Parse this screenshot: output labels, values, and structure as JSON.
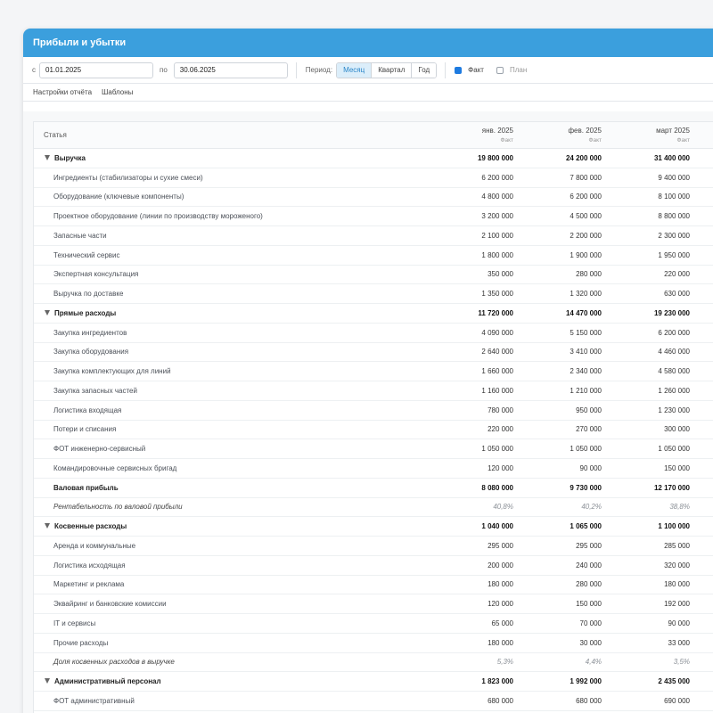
{
  "window": {
    "title": "Прибыли и убытки"
  },
  "toolbar": {
    "from_label": "с",
    "from_value": "01.01.2025",
    "to_label": "по",
    "to_value": "30.06.2025",
    "period_label": "Период:",
    "period_options": [
      "Месяц",
      "Квартал",
      "Год"
    ],
    "period_selected": "Месяц",
    "fact_label": "Факт",
    "fact_checked": true,
    "plan_label": "План",
    "plan_checked": false,
    "accent_color": "#3b9fdd"
  },
  "tabs": [
    "Настройки отчёта",
    "Шаблоны"
  ],
  "table": {
    "stat_header": "Статья",
    "columns": [
      {
        "month": "янв. 2025",
        "sub": "Факт"
      },
      {
        "month": "фев. 2025",
        "sub": "Факт"
      },
      {
        "month": "март 2025",
        "sub": "Факт"
      }
    ],
    "rows": [
      {
        "type": "group",
        "name": "Выручка",
        "values": [
          "19 800 000",
          "24 200 000",
          "31 400 000"
        ]
      },
      {
        "type": "item",
        "name": "Ингредиенты (стабилизаторы и сухие смеси)",
        "values": [
          "6 200 000",
          "7 800 000",
          "9 400 000"
        ]
      },
      {
        "type": "item",
        "name": "Оборудование (ключевые компоненты)",
        "values": [
          "4 800 000",
          "6 200 000",
          "8 100 000"
        ]
      },
      {
        "type": "item",
        "name": "Проектное оборудование (линии по производству мороженого)",
        "values": [
          "3 200 000",
          "4 500 000",
          "8 800 000"
        ]
      },
      {
        "type": "item",
        "name": "Запасные части",
        "values": [
          "2 100 000",
          "2 200 000",
          "2 300 000"
        ]
      },
      {
        "type": "item",
        "name": "Технический сервис",
        "values": [
          "1 800 000",
          "1 900 000",
          "1 950 000"
        ]
      },
      {
        "type": "item",
        "name": "Экспертная консультация",
        "values": [
          "350 000",
          "280 000",
          "220 000"
        ]
      },
      {
        "type": "item",
        "name": "Выручка по доставке",
        "values": [
          "1 350 000",
          "1 320 000",
          "630 000"
        ]
      },
      {
        "type": "group",
        "name": "Прямые расходы",
        "values": [
          "11 720 000",
          "14 470 000",
          "19 230 000"
        ]
      },
      {
        "type": "item",
        "name": "Закупка ингредиентов",
        "values": [
          "4 090 000",
          "5 150 000",
          "6 200 000"
        ]
      },
      {
        "type": "item",
        "name": "Закупка оборудования",
        "values": [
          "2 640 000",
          "3 410 000",
          "4 460 000"
        ]
      },
      {
        "type": "item",
        "name": "Закупка комплектующих для линий",
        "values": [
          "1 660 000",
          "2 340 000",
          "4 580 000"
        ]
      },
      {
        "type": "item",
        "name": "Закупка запасных частей",
        "values": [
          "1 160 000",
          "1 210 000",
          "1 260 000"
        ]
      },
      {
        "type": "item",
        "name": "Логистика входящая",
        "values": [
          "780 000",
          "950 000",
          "1 230 000"
        ]
      },
      {
        "type": "item",
        "name": "Потери и списания",
        "values": [
          "220 000",
          "270 000",
          "300 000"
        ]
      },
      {
        "type": "item",
        "name": "ФОТ инженерно-сервисный",
        "values": [
          "1 050 000",
          "1 050 000",
          "1 050 000"
        ]
      },
      {
        "type": "item",
        "name": "Командировочные сервисных бригад",
        "values": [
          "120 000",
          "90 000",
          "150 000"
        ]
      },
      {
        "type": "sum",
        "name": "Валовая прибыль",
        "values": [
          "8 080 000",
          "9 730 000",
          "12 170 000"
        ]
      },
      {
        "type": "ratio",
        "name": "Рентабельность по валовой прибыли",
        "values": [
          "40,8%",
          "40,2%",
          "38,8%"
        ]
      },
      {
        "type": "group",
        "name": "Косвенные расходы",
        "values": [
          "1 040 000",
          "1 065 000",
          "1 100 000"
        ]
      },
      {
        "type": "item",
        "name": "Аренда и коммунальные",
        "values": [
          "295 000",
          "295 000",
          "285 000"
        ]
      },
      {
        "type": "item",
        "name": "Логистика исходящая",
        "values": [
          "200 000",
          "240 000",
          "320 000"
        ]
      },
      {
        "type": "item",
        "name": "Маркетинг и реклама",
        "values": [
          "180 000",
          "280 000",
          "180 000"
        ]
      },
      {
        "type": "item",
        "name": "Эквайринг и банковские комиссии",
        "values": [
          "120 000",
          "150 000",
          "192 000"
        ]
      },
      {
        "type": "item",
        "name": "IT и сервисы",
        "values": [
          "65 000",
          "70 000",
          "90 000"
        ]
      },
      {
        "type": "item",
        "name": "Прочие расходы",
        "values": [
          "180 000",
          "30 000",
          "33 000"
        ]
      },
      {
        "type": "ratio",
        "name": "Доля косвенных расходов в выручке",
        "values": [
          "5,3%",
          "4,4%",
          "3,5%"
        ]
      },
      {
        "type": "group",
        "name": "Административный персонал",
        "values": [
          "1 823 000",
          "1 992 000",
          "2 435 000"
        ]
      },
      {
        "type": "item",
        "name": "ФОТ административный",
        "values": [
          "680 000",
          "680 000",
          "690 000"
        ]
      }
    ]
  }
}
